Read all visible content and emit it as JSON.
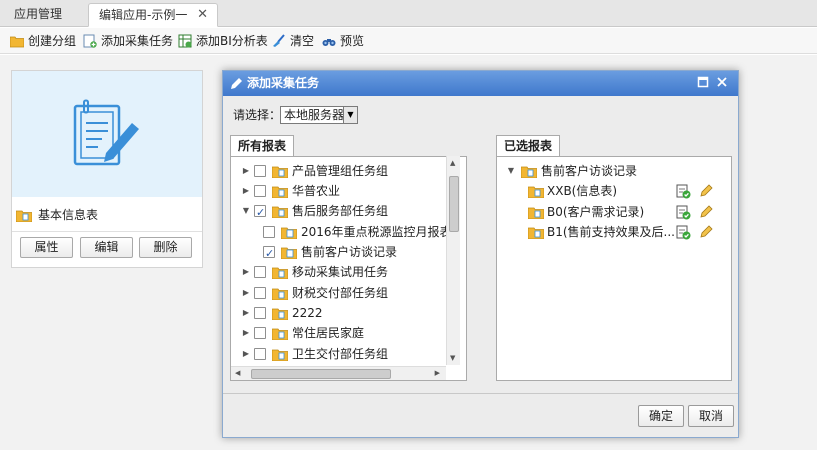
{
  "tabs": {
    "app_manage": "应用管理",
    "edit_app": "编辑应用-示例一",
    "close_glyph": "✕"
  },
  "toolbar": {
    "create_group": "创建分组",
    "add_collect_task": "添加采集任务",
    "add_bi_table": "添加BI分析表",
    "clear": "清空",
    "preview": "预览"
  },
  "card": {
    "title": "基本信息表",
    "btn_props": "属性",
    "btn_edit": "编辑",
    "btn_delete": "删除"
  },
  "dialog": {
    "title": "添加采集任务",
    "select_label": "请选择：",
    "select_value": "本地服务器",
    "left_tab": "所有报表",
    "right_tab": "已选报表",
    "ok": "确定",
    "cancel": "取消"
  },
  "all_reports": [
    {
      "label": "产品管理组任务组",
      "checked": false,
      "expanded": false
    },
    {
      "label": "华普农业",
      "checked": false,
      "expanded": false
    },
    {
      "label": "售后服务部任务组",
      "checked": true,
      "expanded": true
    },
    {
      "label": "2016年重点税源监控月报表(…",
      "checked": false,
      "child": true
    },
    {
      "label": "售前客户访谈记录",
      "checked": true,
      "child": true
    },
    {
      "label": "移动采集试用任务",
      "checked": false,
      "expanded": false
    },
    {
      "label": "财税交付部任务组",
      "checked": false,
      "expanded": false
    },
    {
      "label": "2222",
      "checked": false,
      "expanded": false
    },
    {
      "label": "常住居民家庭",
      "checked": false,
      "expanded": false
    },
    {
      "label": "卫生交付部任务组",
      "checked": false,
      "expanded": false
    }
  ],
  "selected_reports": {
    "parent": "售前客户访谈记录",
    "items": [
      {
        "label": "XXB(信息表)"
      },
      {
        "label": "B0(客户需求记录)"
      },
      {
        "label": "B1(售前支持效果及后..."
      }
    ]
  },
  "colors": {
    "dialog_header": "#3f78cc",
    "folder": "#f2b632",
    "accent": "#3a8fd8"
  }
}
